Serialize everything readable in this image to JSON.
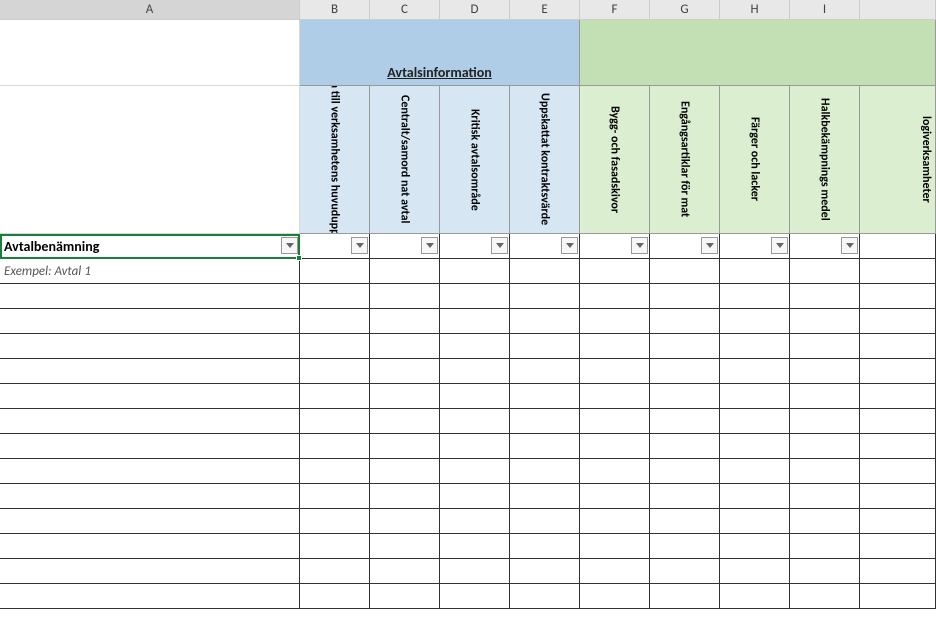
{
  "columns": {
    "A": "A",
    "B": "B",
    "C": "C",
    "D": "D",
    "E": "E",
    "F": "F",
    "G": "G",
    "H": "H",
    "I": "I"
  },
  "group_headers": {
    "blue": "Avtalsinformation"
  },
  "vertical_headers": {
    "B": "Bidra till verksamhetens huvuduppdrag",
    "C": "Centralt/samord nat avtal",
    "D": "Kritisk avtalsområde",
    "E": "Uppskattat kontraktsvärde",
    "F": "Bygg- och fasadskivor",
    "G": "Engångsartiklar för mat",
    "H": "Färger och lacker",
    "I": "Halkbekämpnings medel",
    "J": "logiverksamheter"
  },
  "filter_row": {
    "A": "Avtalbenämning"
  },
  "data_row": {
    "A": "Exempel: Avtal 1"
  }
}
